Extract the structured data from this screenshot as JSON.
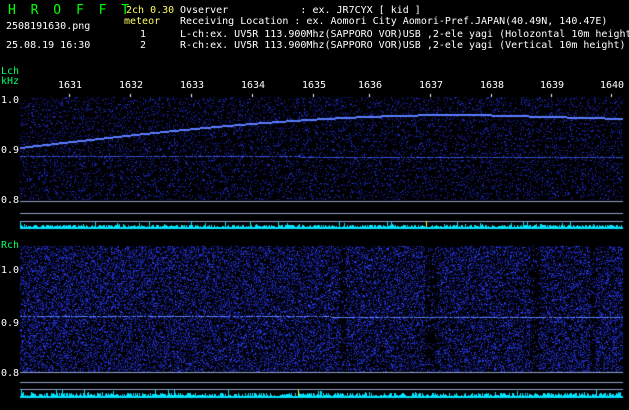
{
  "header": {
    "logo": "H R O F F T",
    "filename": "2508191630.png",
    "datetime": "25.08.19 16:30",
    "version": "2ch 0.30",
    "meteor_label": "meteor",
    "meteor_count_l": "1",
    "meteor_count_r": "2",
    "observer": "Ovserver            : ex. JR7CYX [ kid ]",
    "location": "Receiving Location : ex. Aomori City Aomori-Pref.JAPAN(40.49N, 140.47E)",
    "lch_info": "L-ch:ex. UV5R 113.900Mhz(SAPPORO VOR)USB ,2-ele yagi (Holozontal 10m height)",
    "rch_info": "R-ch:ex. UV5R 113.900Mhz(SAPPORO VOR)USB ,2-ele yagi (Vertical 10m height)"
  },
  "lch": {
    "label": "Lch",
    "unit": "kHz",
    "yticks": [
      "1.0",
      "0.9",
      "0.8"
    ]
  },
  "rch": {
    "label": "Rch",
    "yticks": [
      "1.0",
      "0.9",
      "0.8"
    ]
  },
  "time_ticks": [
    "1631",
    "1632",
    "1633",
    "1634",
    "1635",
    "1636",
    "1637",
    "1638",
    "1639",
    "1640"
  ],
  "colors": {
    "background": "#000000",
    "noise": "#1a2ca8",
    "signal": "#5a7cff",
    "histogram": "#00e5ff",
    "guide": "#8fa0c8",
    "logo": "#00ff00"
  }
}
